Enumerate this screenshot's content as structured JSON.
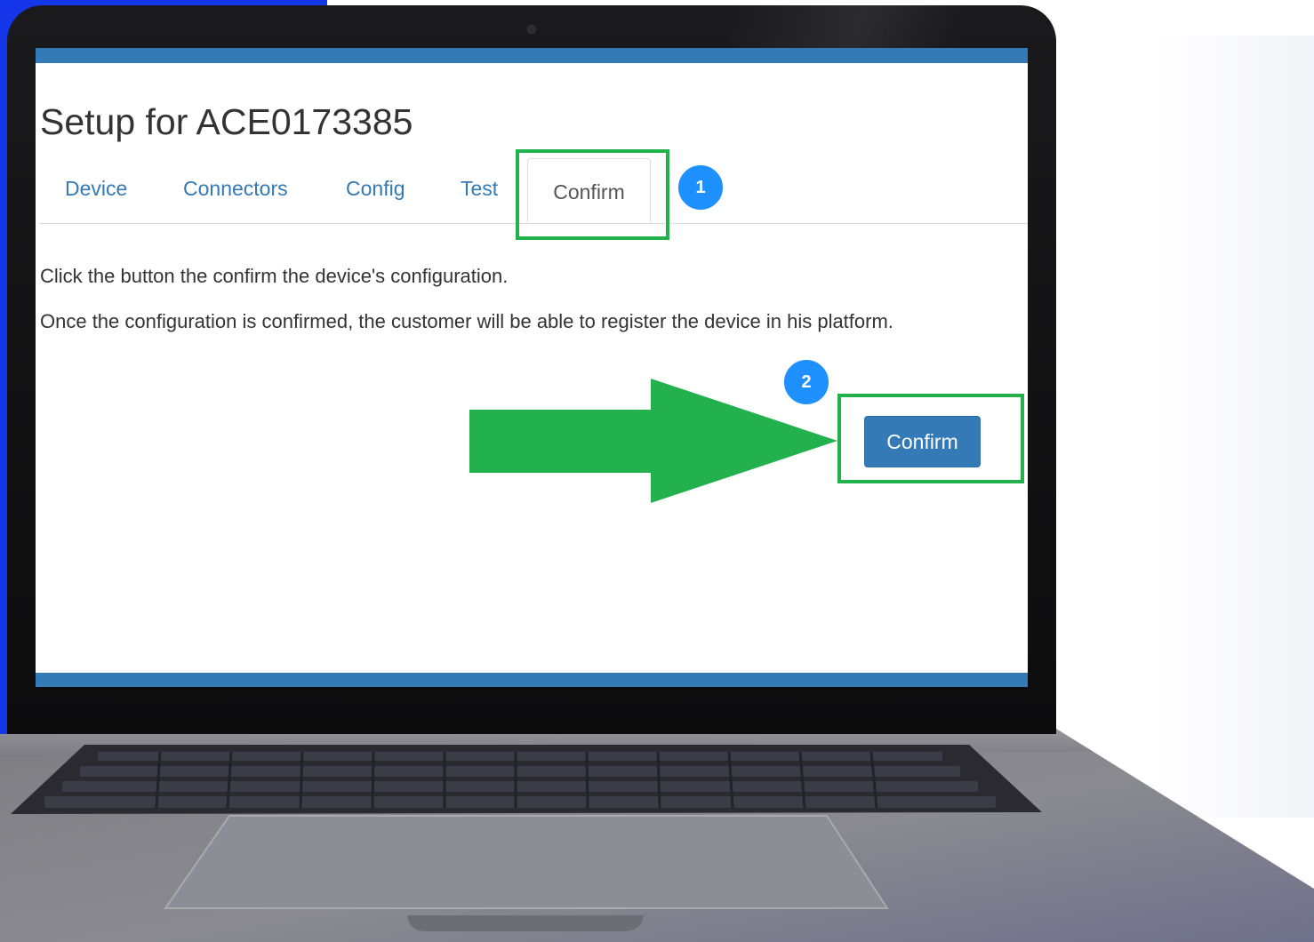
{
  "page": {
    "title": "Setup for ACE0173385",
    "tabs": [
      {
        "label": "Device",
        "active": false
      },
      {
        "label": "Connectors",
        "active": false
      },
      {
        "label": "Config",
        "active": false
      },
      {
        "label": "Test",
        "active": false
      },
      {
        "label": "Confirm",
        "active": true
      }
    ],
    "paragraphs": [
      "Click the button the confirm the device's configuration.",
      "Once the configuration is confirmed, the customer will be able to register the device in his platform."
    ],
    "confirm_button_label": "Confirm"
  },
  "annotations": {
    "step_1": "1",
    "step_2": "2",
    "highlight_color": "#22b14c",
    "badge_color": "#1e90ff",
    "arrow_icon": "arrow-right-icon"
  },
  "colors": {
    "link": "#337ab7",
    "primary_button": "#337ab7",
    "background_accent": "#1436e8"
  }
}
